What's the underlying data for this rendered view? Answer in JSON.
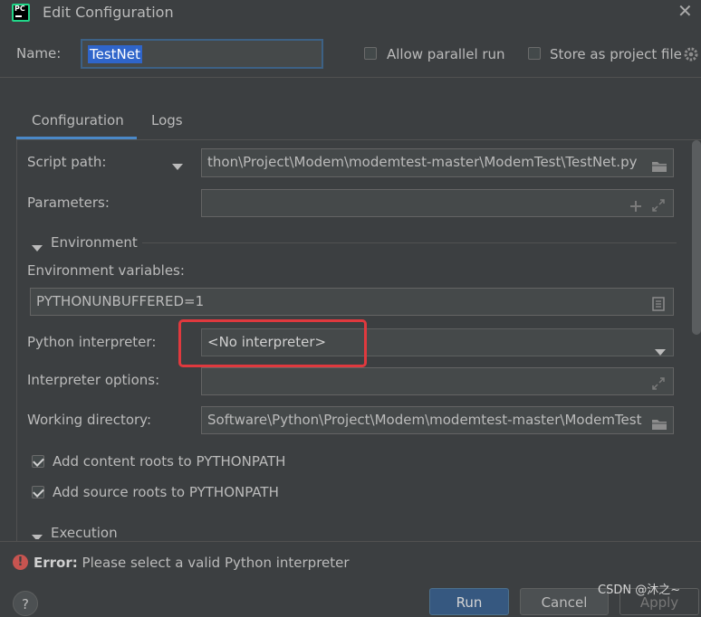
{
  "window": {
    "app_icon_text": "PC",
    "title": "Edit Configuration",
    "close": "✕"
  },
  "header": {
    "name_label": "Name:",
    "name_value": "TestNet",
    "allow_parallel_label": "Allow parallel run",
    "allow_parallel_checked": false,
    "store_project_label": "Store as project file",
    "store_project_checked": false
  },
  "tabs": [
    {
      "label": "Configuration",
      "selected": true
    },
    {
      "label": "Logs",
      "selected": false
    }
  ],
  "config": {
    "script_path_label": "Script path:",
    "script_path_value": "thon\\Project\\Modem\\modemtest-master\\ModemTest\\TestNet.py",
    "parameters_label": "Parameters:",
    "parameters_value": "",
    "environment_section": "Environment",
    "env_vars_label": "Environment variables:",
    "env_vars_value": "PYTHONUNBUFFERED=1",
    "interpreter_label": "Python interpreter:",
    "interpreter_value": "<No interpreter>",
    "interp_options_label": "Interpreter options:",
    "interp_options_value": "",
    "working_dir_label": "Working directory:",
    "working_dir_value": "Software\\Python\\Project\\Modem\\modemtest-master\\ModemTest",
    "add_content_roots_label": "Add content roots to PYTHONPATH",
    "add_content_roots_checked": true,
    "add_source_roots_label": "Add source roots to PYTHONPATH",
    "add_source_roots_checked": true,
    "execution_section": "Execution"
  },
  "error": {
    "icon": "!",
    "bold": "Error:",
    "message": "Please select a valid Python interpreter"
  },
  "buttons": {
    "help": "?",
    "run": "Run",
    "cancel": "Cancel",
    "apply": "Apply"
  },
  "watermark": "CSDN @沐之~",
  "colors": {
    "background": "#3c3f41",
    "accent": "#4a88c7",
    "error": "#e0393e",
    "selection": "#2f65ca"
  }
}
